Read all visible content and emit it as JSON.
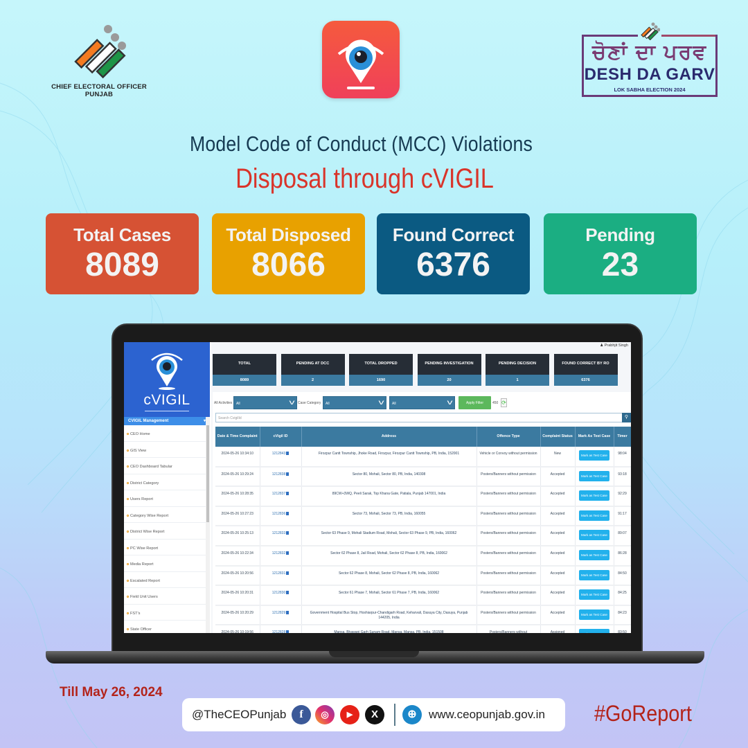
{
  "header": {
    "org_name_line1": "CHIEF ELECTORAL OFFICER",
    "org_name_line2": "PUNJAB",
    "app_icon": "cvigil-eye-pin-icon",
    "campaign_punjabi": "ਚੋਣਾਂ ਦਾ ਪਰਵ",
    "campaign_title": "DESH DA GARV",
    "campaign_subtitle": "LOK SABHA ELECTION 2024"
  },
  "titles": {
    "line1": "Model Code of Conduct (MCC) Violations",
    "line2": "Disposal through cVIGIL"
  },
  "stat_cards": [
    {
      "label": "Total Cases",
      "value": "8089",
      "color": "#d65234"
    },
    {
      "label": "Total Disposed",
      "value": "8066",
      "color": "#e8a100"
    },
    {
      "label": "Found Correct",
      "value": "6376",
      "color": "#0b5a82"
    },
    {
      "label": "Pending",
      "value": "23",
      "color": "#1bae82"
    }
  ],
  "dashboard": {
    "brand": "cVIGIL",
    "user_name": "Prabhjit Singh",
    "sidebar": {
      "menu_title": "CVIGIL Management",
      "items": [
        "CEO Home",
        "GIS View",
        "CEO Dashboard Tabular",
        "District Category",
        "Users Report",
        "Category Wise Report",
        "District Wise Report",
        "PC Wise Report",
        "Media Report",
        "Escalated Report",
        "Field Unit Users",
        "FST's",
        "State Officer"
      ]
    },
    "kpis": [
      {
        "label": "TOTAL",
        "value": "8089"
      },
      {
        "label": "PENDING AT DCC",
        "value": "2"
      },
      {
        "label": "TOTAL DROPPED",
        "value": "1690"
      },
      {
        "label": "PENDING INVESTIGATION",
        "value": "20"
      },
      {
        "label": "PENDING DECISION",
        "value": "1"
      },
      {
        "label": "FOUND CORRECT BY RO",
        "value": "6376"
      }
    ],
    "filters": {
      "activities_label": "All Activities",
      "activities_value": "All",
      "category_label": "Case Category",
      "category_value": "All",
      "third_value": "All",
      "apply_label": "Apply Filter",
      "count": "450",
      "search_placeholder": "Search CvigilId"
    },
    "table": {
      "columns": [
        "Date & Time Complaint",
        "cVigil ID",
        "Address",
        "Offence Type",
        "Complaint Status",
        "Mark As Test Case",
        "Timer"
      ],
      "action_label": "Mark as Test Case",
      "rows": [
        {
          "datetime": "2024-05-26 10:34:10",
          "id": "1212843",
          "address": "Firozpur Cantt Township, Jhoke Road, Firozpur, Firozpur Cantt Township, PB, India, 152001",
          "offence": "Vehicle or Convoy without permission",
          "status": "New",
          "timer": "98:04"
        },
        {
          "datetime": "2024-05-26 10:29:24",
          "id": "1212838",
          "address": "Sector 80, Mohali, Sector 80, PB, India, 140308",
          "offence": "Posters/Banners without permission",
          "status": "Accepted",
          "timer": "93:18"
        },
        {
          "datetime": "2024-05-26 10:28:35",
          "id": "1212837",
          "address": "89CW+3WQ, Peeli Sarak, Top Khana Gate, Patiala, Punjab 147001, India",
          "offence": "Posters/Banners without permission",
          "status": "Accepted",
          "timer": "92:29"
        },
        {
          "datetime": "2024-05-26 10:27:23",
          "id": "1212836",
          "address": "Sector 73, Mohali, Sector 73, PB, India, 160055",
          "offence": "Posters/Banners without permission",
          "status": "Accepted",
          "timer": "91:17"
        },
        {
          "datetime": "2024-05-26 10:25:13",
          "id": "1212833",
          "address": "Sector 63 Phase 9, Mohali Stadium Road, Mohali, Sector 63 Phase 9, PB, India, 160062",
          "offence": "Posters/Banners without permission",
          "status": "Accepted",
          "timer": "89:07"
        },
        {
          "datetime": "2024-05-26 10:22:34",
          "id": "1212832",
          "address": "Sector 62 Phase 8, Jail Road, Mohali, Sector 62 Phase 8, PB, India, 160062",
          "offence": "Posters/Banners without permission",
          "status": "Accepted",
          "timer": "86:28"
        },
        {
          "datetime": "2024-05-26 10:20:56",
          "id": "1212831",
          "address": "Sector 62 Phase 8, Mohali, Sector 62 Phase 8, PB, India, 160062",
          "offence": "Posters/Banners without permission",
          "status": "Accepted",
          "timer": "84:50"
        },
        {
          "datetime": "2024-05-26 10:20:31",
          "id": "1212830",
          "address": "Sector 61 Phase 7, Mohali, Sector 61 Phase 7, PB, India, 160062",
          "offence": "Posters/Banners without permission",
          "status": "Accepted",
          "timer": "84:25"
        },
        {
          "datetime": "2024-05-26 10:20:29",
          "id": "1212829",
          "address": "Government Hospital Bus Stop, Hoshiarpur-Chandigarh Road, Keharvali, Dasuya City, Dasuya, Punjab 144205, India",
          "offence": "Posters/Banners without permission",
          "status": "Accepted",
          "timer": "84:23"
        },
        {
          "datetime": "2024-05-26 10:19:56",
          "id": "1212828",
          "address": "Mansa, Bhawani Garh Sunam Road, Mansa, Mansa, PB, India, 151508",
          "offence": "Posters/Banners without",
          "status": "Assigned",
          "timer": "83:50"
        }
      ]
    }
  },
  "footer": {
    "date_note": "Till May 26, 2024",
    "handle": "@TheCEOPunjab",
    "social_icons": [
      "facebook-icon",
      "instagram-icon",
      "youtube-icon",
      "x-icon"
    ],
    "website_icon": "globe-icon",
    "website": "www.ceopunjab.gov.in",
    "hashtag": "#GoReport"
  }
}
